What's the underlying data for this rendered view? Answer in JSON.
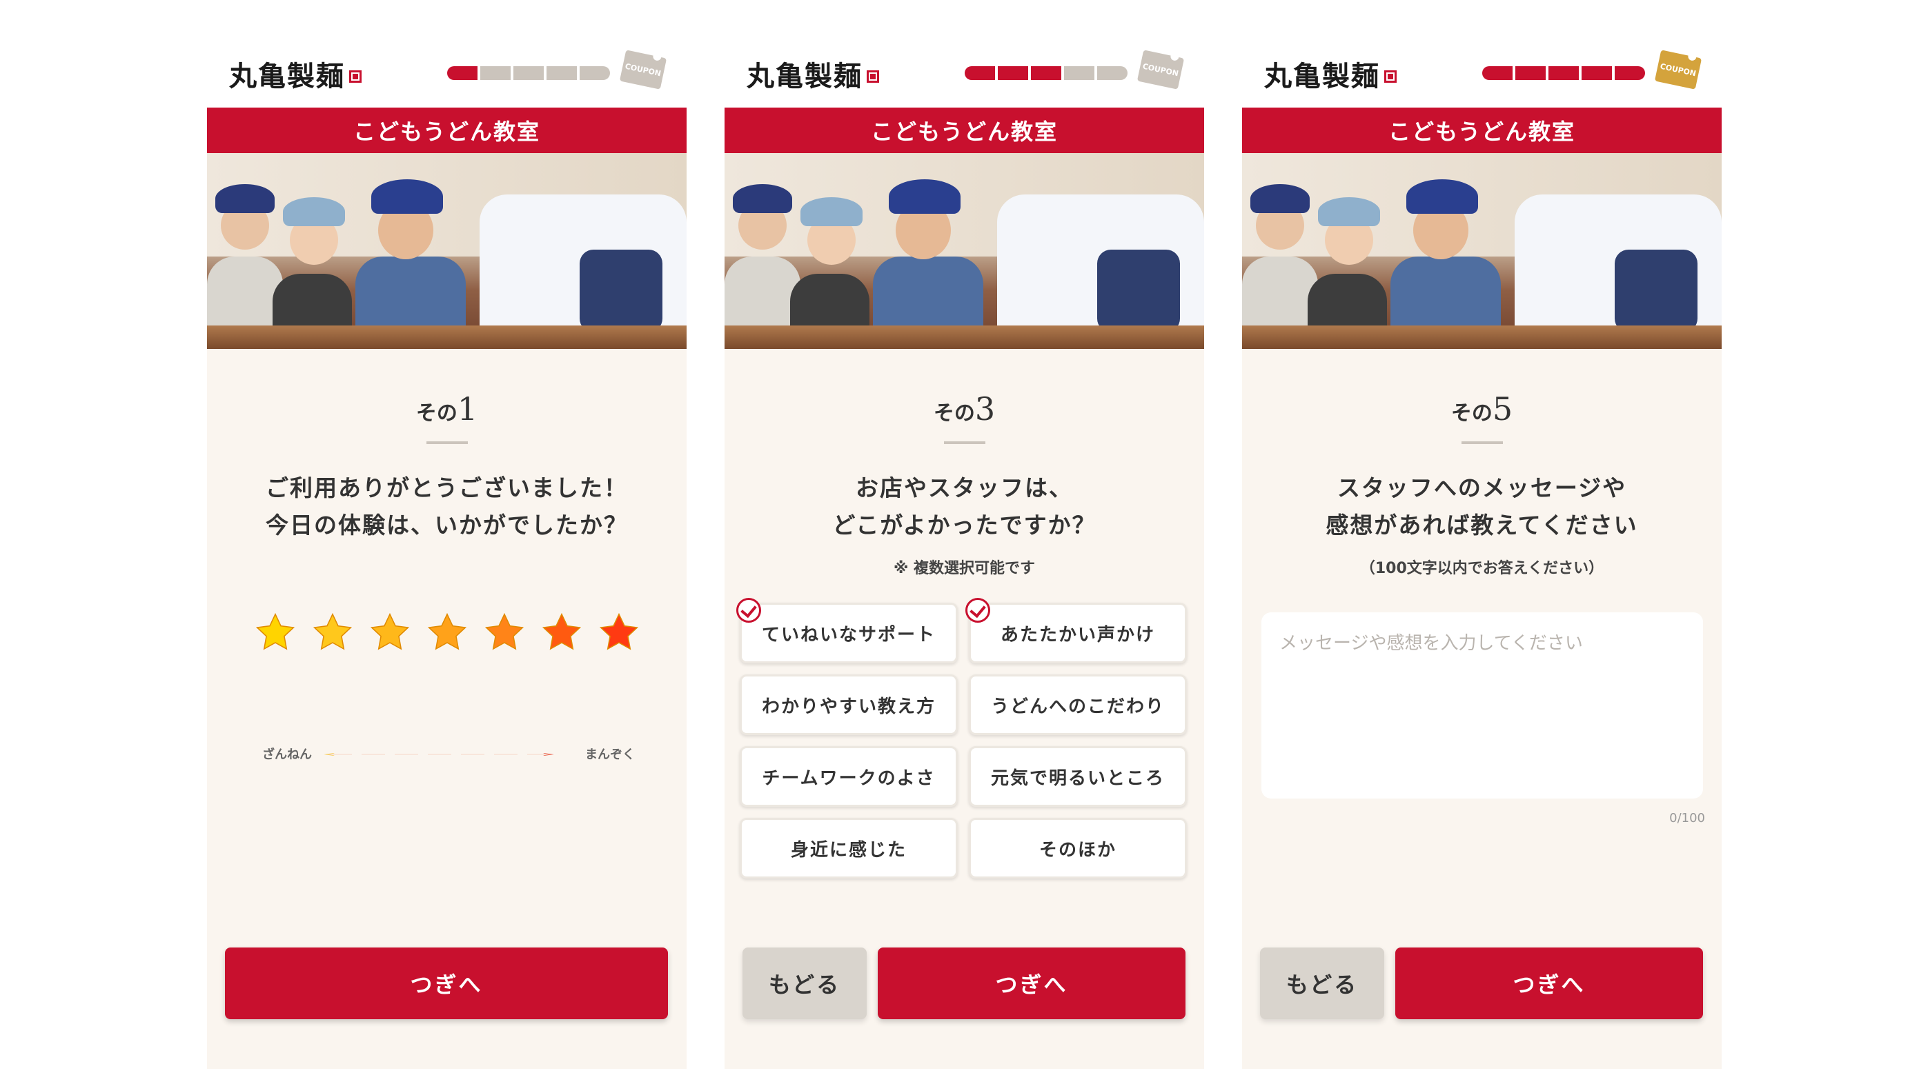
{
  "brand": {
    "logo_text": "丸亀製麺"
  },
  "common": {
    "banner_title": "こどもうどん教室",
    "coupon_label": "COUPON",
    "step_prefix": "その",
    "next_label": "つぎへ",
    "back_label": "もどる"
  },
  "screen1": {
    "step_number": "1",
    "progress": {
      "filled": 1,
      "total": 5
    },
    "question_line1": "ご利用ありがとうございました！",
    "question_line2": "今日の体験は、いかがでしたか？",
    "rating": {
      "max": 7,
      "star_colors": [
        "#ffd400",
        "#ffc81c",
        "#ffb81a",
        "#ffa21a",
        "#ff8418",
        "#ff5a10",
        "#ff3a12"
      ]
    },
    "scale_left": "ざんねん",
    "scale_right": "まんぞく"
  },
  "screen2": {
    "step_number": "3",
    "progress": {
      "filled": 3,
      "total": 5
    },
    "question_line1": "お店やスタッフは、",
    "question_line2": "どこがよかったですか？",
    "note": "※ 複数選択可能です",
    "options": [
      {
        "label": "ていねいなサポート",
        "selected": true
      },
      {
        "label": "あたたかい声かけ",
        "selected": true
      },
      {
        "label": "わかりやすい教え方",
        "selected": false
      },
      {
        "label": "うどんへのこだわり",
        "selected": false
      },
      {
        "label": "チームワークのよさ",
        "selected": false
      },
      {
        "label": "元気で明るいところ",
        "selected": false
      },
      {
        "label": "身近に感じた",
        "selected": false
      },
      {
        "label": "そのほか",
        "selected": false
      }
    ]
  },
  "screen3": {
    "step_number": "5",
    "progress": {
      "filled": 5,
      "total": 5
    },
    "question_line1": "スタッフへのメッセージや",
    "question_line2": "感想があれば教えてください",
    "note": "（100文字以内でお答えください）",
    "placeholder": "メッセージや感想を入力してください",
    "counter": "0/100"
  },
  "colors": {
    "accent": "#c8102e",
    "background": "#faf5ef",
    "inactive": "#cbc4bc",
    "coupon_active": "#d4a33c"
  }
}
